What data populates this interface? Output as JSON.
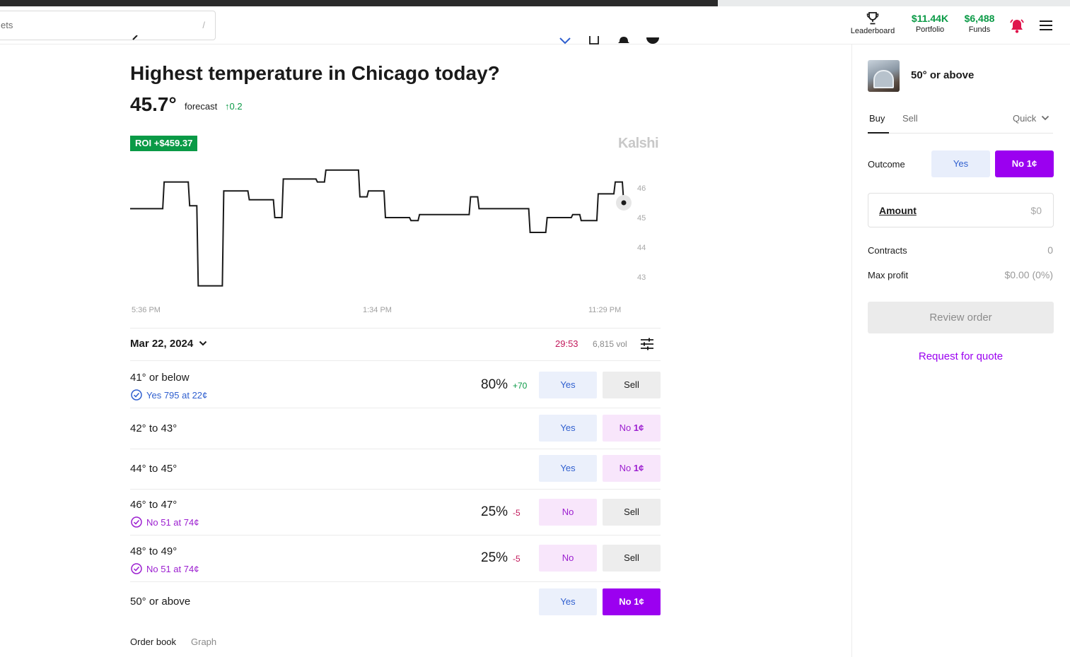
{
  "header": {
    "search_text": "ets",
    "search_shortcut": "/",
    "leaderboard_label": "Leaderboard",
    "portfolio_value": "$11.44K",
    "portfolio_label": "Portfolio",
    "funds_value": "$6,488",
    "funds_label": "Funds",
    "icons": [
      "trophy-icon",
      "bell-icon",
      "menu-icon"
    ]
  },
  "market": {
    "title": "Highest temperature in Chicago today?",
    "forecast_value": "45.7°",
    "forecast_label": "forecast",
    "forecast_change": "↑0.2",
    "roi_badge": "ROI +$459.37",
    "brand": "Kalshi"
  },
  "chart_data": {
    "type": "line",
    "x_tick_labels": [
      "5:36 PM",
      "1:34 PM",
      "11:29 PM"
    ],
    "y_tick_labels": [
      "46",
      "45",
      "44",
      "43"
    ],
    "ylim": [
      42.8,
      47.6
    ],
    "series": [
      {
        "values": [
          45.3,
          45.3,
          45.3,
          45.3,
          46.2,
          46.2,
          46.2,
          45.4,
          42.7,
          42.7,
          42.7,
          45.9,
          45.9,
          45.9,
          45.6,
          45.6,
          45.6,
          45.0,
          46.3,
          46.3,
          46.3,
          46.3,
          46.2,
          46.6,
          46.6,
          46.6,
          46.6,
          45.7,
          45.9,
          45.9,
          45.0,
          45.0,
          45.0,
          44.9,
          45.1,
          45.1,
          45.1,
          45.1,
          45.1,
          45.1,
          45.7,
          45.3,
          45.3,
          45.3,
          45.3,
          45.3,
          45.3,
          44.5,
          44.5,
          45.0,
          45.0,
          45.0,
          45.1,
          44.9,
          44.9,
          45.8,
          45.8,
          46.2,
          45.5
        ]
      }
    ],
    "grid": false,
    "legend": "none",
    "current_marker": "end"
  },
  "market_bar": {
    "date": "Mar 22, 2024",
    "timer": "29:53",
    "volume": "6,815 vol"
  },
  "rows": [
    {
      "label": "41° or below",
      "sub": "Yes 795 at 22¢",
      "pct": "80%",
      "chg": "+70",
      "btn1": "Yes",
      "btn2": "Sell"
    },
    {
      "label": "42° to 43°",
      "btn1": "Yes",
      "btn2_prefix": "No",
      "btn2_price": "1¢"
    },
    {
      "label": "44° to 45°",
      "btn1": "Yes",
      "btn2_prefix": "No",
      "btn2_price": "1¢"
    },
    {
      "label": "46° to 47°",
      "sub": "No 51 at 74¢",
      "pct": "25%",
      "chg": "-5",
      "btn1": "No",
      "btn2": "Sell"
    },
    {
      "label": "48° to 49°",
      "sub": "No 51 at 74¢",
      "pct": "25%",
      "chg": "-5",
      "btn1": "No",
      "btn2": "Sell"
    },
    {
      "label": "50° or above",
      "btn1": "Yes",
      "btn2": "No 1¢"
    }
  ],
  "footer_tabs": [
    "Order book",
    "Graph"
  ],
  "side": {
    "title": "50° or above",
    "tabs": {
      "buy": "Buy",
      "sell": "Sell",
      "quick": "Quick"
    },
    "outcome_label": "Outcome",
    "outcome_yes": "Yes",
    "outcome_no": "No 1¢",
    "amount_label": "Amount",
    "amount_value": "$0",
    "contracts_label": "Contracts",
    "contracts_value": "0",
    "max_profit_label": "Max profit",
    "max_profit_value": "$0.00 (0%)",
    "review_button": "Review order",
    "rfq_link": "Request for quote"
  },
  "colors": {
    "green": "#0a9a46",
    "purple": "#9b00f0",
    "blue": "#2f5fcf",
    "timer_red": "#c2185b"
  }
}
